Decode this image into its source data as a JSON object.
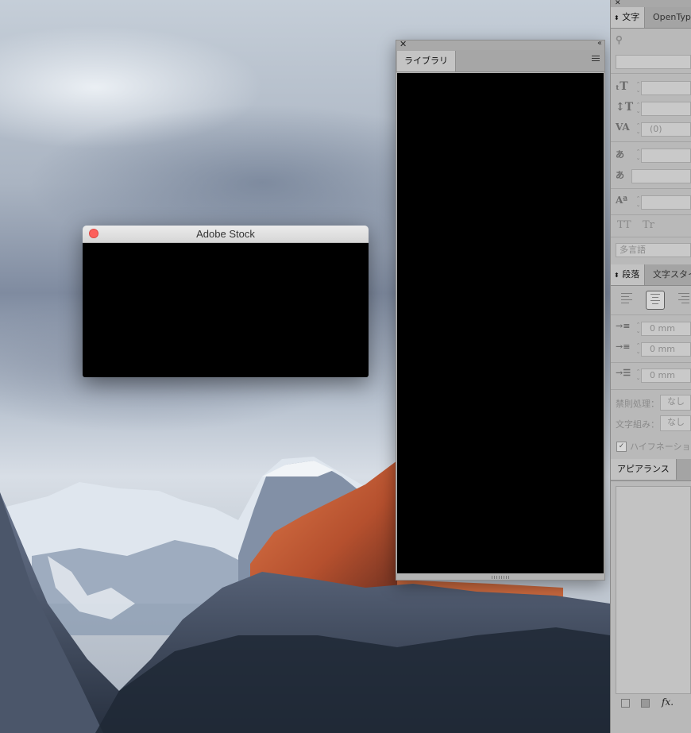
{
  "stock_window": {
    "title": "Adobe Stock"
  },
  "library_panel": {
    "tab_label": "ライブラリ",
    "close_glyph": "✕",
    "collapse_glyph": "‹‹"
  },
  "character_panel": {
    "tab_label": "文字",
    "tab2_label": "OpenType",
    "leading_value": "(0)",
    "tt_label": "TT",
    "tr_label": "Tr",
    "language_label": "多言語"
  },
  "paragraph_panel": {
    "tab_label": "段落",
    "tab2_label": "文字スタイル",
    "left_indent": "0 mm",
    "first_indent": "0 mm",
    "space_before": "0 mm",
    "kinsoku_label": "禁則処理：",
    "kinsoku_value": "なし",
    "mojikumi_label": "文字組み：",
    "mojikumi_value": "なし",
    "hyphenation_label": "ハイフネーション",
    "hyphenation_checked": true
  },
  "appearance_panel": {
    "tab_label": "アピアランス",
    "fx_label": "fx."
  }
}
